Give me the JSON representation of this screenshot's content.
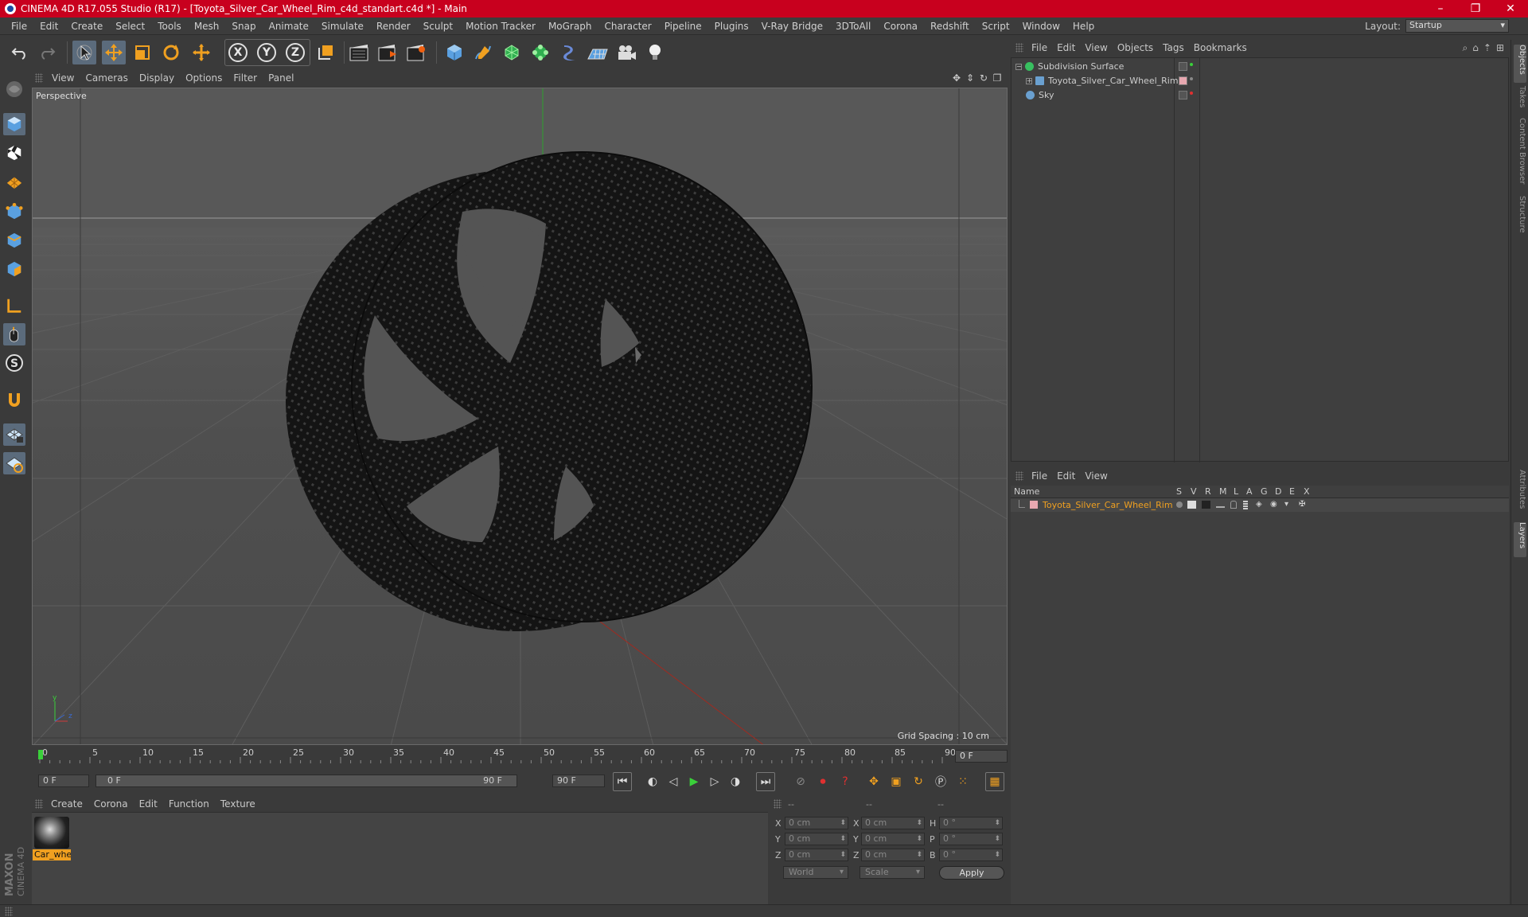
{
  "window": {
    "title": "CINEMA 4D R17.055 Studio (R17) - [Toyota_Silver_Car_Wheel_Rim_c4d_standart.c4d *] - Main",
    "buttons": {
      "minimize": "–",
      "restore": "❐",
      "close": "✕"
    }
  },
  "menubar": {
    "items": [
      "File",
      "Edit",
      "Create",
      "Select",
      "Tools",
      "Mesh",
      "Snap",
      "Animate",
      "Simulate",
      "Render",
      "Sculpt",
      "Motion Tracker",
      "MoGraph",
      "Character",
      "Pipeline",
      "Plugins",
      "V-Ray Bridge",
      "3DToAll",
      "Corona",
      "Redshift",
      "Script",
      "Window",
      "Help"
    ],
    "layout_label": "Layout:",
    "layout_value": "Startup"
  },
  "toolbar": {
    "axis_x": "X",
    "axis_y": "Y",
    "axis_z": "Z"
  },
  "viewport": {
    "menu": [
      "View",
      "Cameras",
      "Display",
      "Options",
      "Filter",
      "Panel"
    ],
    "label": "Perspective",
    "grid_spacing": "Grid Spacing : 10 cm"
  },
  "timeline": {
    "ticks": [
      "0",
      "5",
      "10",
      "15",
      "20",
      "25",
      "30",
      "35",
      "40",
      "45",
      "50",
      "55",
      "60",
      "65",
      "70",
      "75",
      "80",
      "85",
      "90"
    ],
    "current_frame": "0 F"
  },
  "transport": {
    "start": "0 F",
    "range_start": "0 F",
    "range_end": "90 F",
    "end": "90 F"
  },
  "materials": {
    "menu": [
      "Create",
      "Corona",
      "Edit",
      "Function",
      "Texture"
    ],
    "items": [
      {
        "name": "Car_whe"
      }
    ]
  },
  "coordinates": {
    "head": [
      "--",
      "--",
      "--"
    ],
    "rows": [
      {
        "axis": "X",
        "pos": "0 cm",
        "axis2": "X",
        "size": "0 cm",
        "rot_label": "H",
        "rot": "0 °"
      },
      {
        "axis": "Y",
        "pos": "0 cm",
        "axis2": "Y",
        "size": "0 cm",
        "rot_label": "P",
        "rot": "0 °"
      },
      {
        "axis": "Z",
        "pos": "0 cm",
        "axis2": "Z",
        "size": "0 cm",
        "rot_label": "B",
        "rot": "0 °"
      }
    ],
    "mode": "World",
    "scale": "Scale",
    "apply": "Apply"
  },
  "object_manager": {
    "menu": [
      "File",
      "Edit",
      "View",
      "Objects",
      "Tags",
      "Bookmarks"
    ],
    "objects": [
      {
        "name": "Subdivision Surface",
        "icon_color": "#38c060"
      },
      {
        "name": "Toyota_Silver_Car_Wheel_Rim",
        "icon_color": "#6aa0d0"
      },
      {
        "name": "Sky",
        "icon_color": "#6aa0d0"
      }
    ]
  },
  "layer_manager": {
    "menu": [
      "File",
      "Edit",
      "View"
    ],
    "columns": [
      "Name",
      "S",
      "V",
      "R",
      "M",
      "L",
      "A",
      "G",
      "D",
      "E",
      "X"
    ],
    "layers": [
      {
        "name": "Toyota_Silver_Car_Wheel_Rim",
        "color": "#f0a020"
      }
    ]
  },
  "right_tabs": [
    "Objects",
    "Takes",
    "Content Browser",
    "Structure",
    "Attributes",
    "Layers"
  ],
  "colors": {
    "title_bar": "#c8001e",
    "accent_orange": "#f0a020",
    "selected_tool": "#5b6b7c"
  }
}
